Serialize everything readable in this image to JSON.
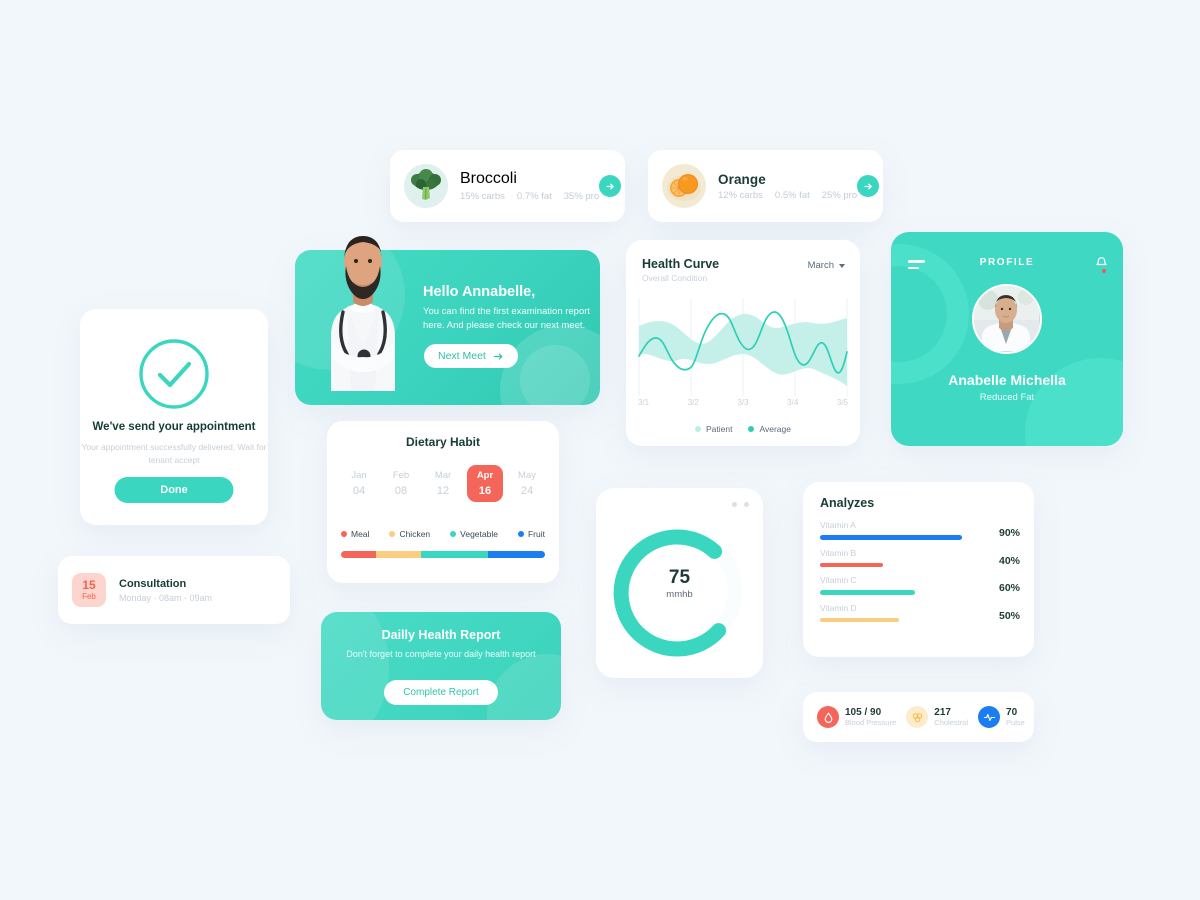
{
  "theme": {
    "accent": "#3ad6c0",
    "coral": "#f4655a",
    "blue": "#1a7ef0",
    "yellow": "#f9c56a",
    "bg": "#f2f7fb"
  },
  "food_cards": [
    {
      "name": "Broccoli",
      "carbs": "15% carbs",
      "fat": "0.7% fat",
      "pro": "35% pro",
      "thumb": "broccoli-image",
      "action": "go-arrow-icon"
    },
    {
      "name": "Orange",
      "carbs": "12% carbs",
      "fat": "0.5% fat",
      "pro": "25% pro",
      "thumb": "orange-image",
      "action": "go-arrow-icon"
    }
  ],
  "hero": {
    "title": "Hello Annabelle,",
    "body": "You can find the first examination report here. And please check our next meet.",
    "button": "Next Meet",
    "button_icon": "arrow-right-icon",
    "doctor_image": "doctor-portrait"
  },
  "health_curve": {
    "title": "Health Curve",
    "subtitle": "Overall Condition",
    "month": "March",
    "legend": [
      {
        "label": "Patient",
        "color": "#bdeee6"
      },
      {
        "label": "Average",
        "color": "#2ecfb8"
      }
    ],
    "chart_data": {
      "type": "area",
      "title": "Health Curve",
      "subtitle": "Overall Condition",
      "xlabel": "",
      "ylabel": "",
      "grid": true,
      "legend_position": "bottom",
      "x": [
        "3/1",
        "3/2",
        "3/3",
        "3/4",
        "3/5"
      ],
      "xlim": [
        0,
        4
      ],
      "ylim": [
        0,
        100
      ],
      "series": [
        {
          "name": "Patient",
          "type": "band",
          "color": "#bdeee6",
          "x": [
            0,
            0.5,
            1,
            1.5,
            2,
            2.5,
            3,
            3.5,
            4
          ],
          "upper": [
            72,
            78,
            62,
            55,
            74,
            84,
            66,
            74,
            80
          ],
          "lower": [
            44,
            50,
            36,
            30,
            44,
            46,
            24,
            28,
            10
          ]
        },
        {
          "name": "Average",
          "type": "line",
          "color": "#2ecfb8",
          "x": [
            0,
            0.25,
            0.5,
            0.75,
            1,
            1.25,
            1.5,
            1.75,
            2,
            2.25,
            2.5,
            2.75,
            3,
            3.25,
            3.5,
            3.75,
            4
          ],
          "values": [
            48,
            62,
            52,
            34,
            33,
            62,
            88,
            72,
            56,
            56,
            78,
            90,
            52,
            30,
            40,
            62,
            30,
            48
          ]
        }
      ]
    }
  },
  "profile": {
    "title": "PROFILE",
    "name": "Anabelle Michella",
    "role": "Reduced Fat",
    "menu_icon": "hamburger-icon",
    "bell_icon": "bell-icon",
    "avatar": "doctor-woman-avatar"
  },
  "appointment": {
    "icon": "check-circle-icon",
    "title": "We've send your appointment",
    "subtitle": "Your appointment successfully delivered, Wait for tenant accept",
    "button": "Done"
  },
  "consultation": {
    "day": "15",
    "month": "Feb",
    "title": "Consultation",
    "meta": "Monday  ·  08am - 09am"
  },
  "dietary": {
    "title": "Dietary Habit",
    "months": [
      {
        "month": "Jan",
        "day": "04",
        "active": false
      },
      {
        "month": "Feb",
        "day": "08",
        "active": false
      },
      {
        "month": "Mar",
        "day": "12",
        "active": false
      },
      {
        "month": "Apr",
        "day": "16",
        "active": true
      },
      {
        "month": "May",
        "day": "24",
        "active": false
      }
    ],
    "chart_data": {
      "type": "bar",
      "title": "Dietary Habit",
      "stacked": true,
      "orientation": "horizontal",
      "categories": [
        "Meal",
        "Chicken",
        "Vegetable",
        "Fruit"
      ],
      "values": [
        17,
        22,
        33,
        28
      ],
      "colors": [
        "#f4655a",
        "#fbcd80",
        "#3ad6c0",
        "#1a7ef0"
      ],
      "ylabel": "",
      "xlabel": "",
      "legend_position": "top"
    }
  },
  "daily_report": {
    "title": "Dailly Health Report",
    "subtitle": "Don't forget to complete your daily health report",
    "button": "Complete Report"
  },
  "gauge": {
    "chart_data": {
      "type": "pie",
      "subtype": "donut-gauge",
      "value": 75,
      "max": 100,
      "unit": "mmhb",
      "label": "75",
      "color": "#3ad6c0",
      "track": "#ffffff"
    }
  },
  "analyzes": {
    "title": "Analyzes",
    "chart_data": {
      "type": "bar",
      "orientation": "horizontal",
      "title": "Analyzes",
      "categories": [
        "Vitamin A",
        "Vitamin B",
        "Vitamin C",
        "Vitamin D"
      ],
      "values": [
        90,
        40,
        60,
        50
      ],
      "value_labels": [
        "90%",
        "40%",
        "60%",
        "50%"
      ],
      "colors": [
        "#1a7ef0",
        "#f4655a",
        "#3ad6c0",
        "#fbcd80"
      ],
      "xlim": [
        0,
        100
      ],
      "grid": false
    }
  },
  "vitals": [
    {
      "value": "105 / 90",
      "label": "Blood Pressure",
      "icon": "blood-drop-icon",
      "color": "#f4655a",
      "bg": "#fbd5ce"
    },
    {
      "value": "217",
      "label": "Cholestrol",
      "icon": "cholesterol-icon",
      "color": "#f6b94a",
      "bg": "#fdeccb"
    },
    {
      "value": "70",
      "label": "Pulse",
      "icon": "pulse-icon",
      "color": "#ffffff",
      "bg": "#1a7ef0"
    }
  ]
}
